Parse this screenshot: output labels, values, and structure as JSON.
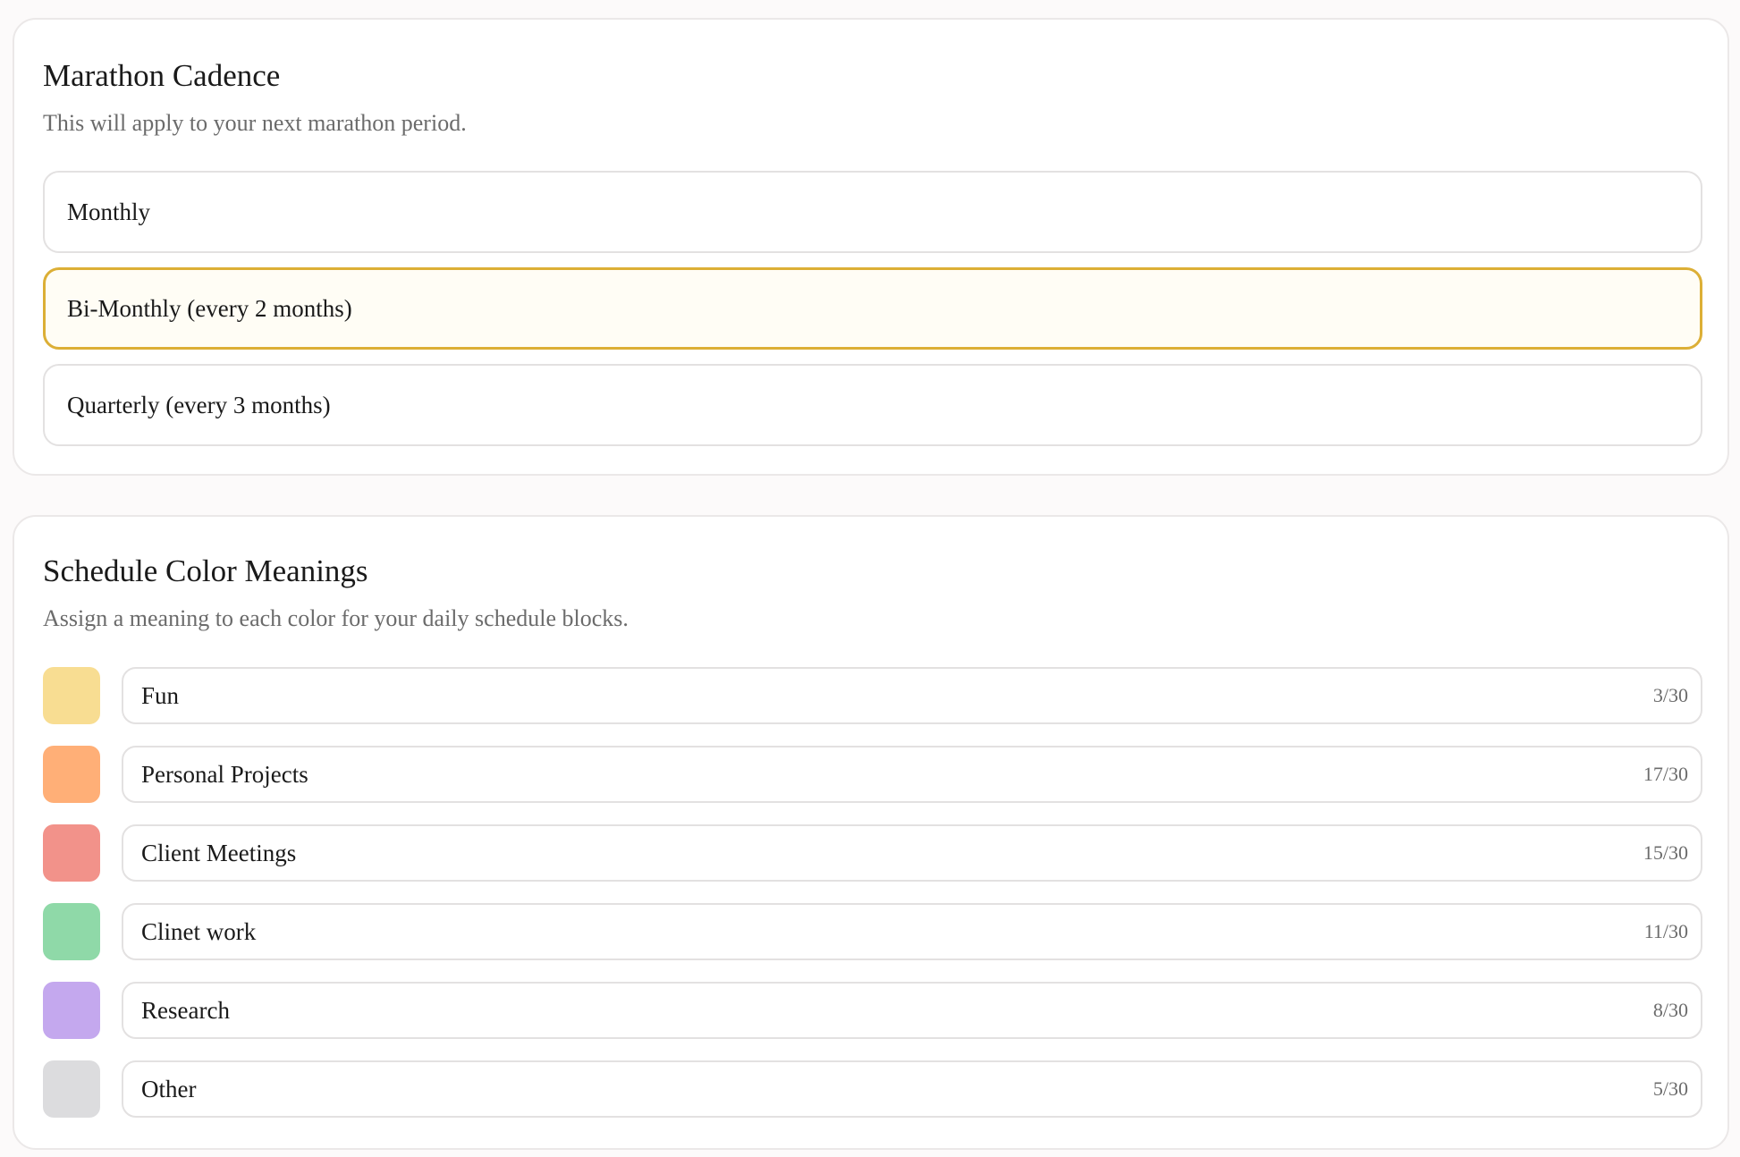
{
  "cadence": {
    "title": "Marathon Cadence",
    "subtitle": "This will apply to your next marathon period.",
    "selected_index": 1,
    "options": [
      {
        "label": "Monthly"
      },
      {
        "label": "Bi-Monthly (every 2 months)"
      },
      {
        "label": "Quarterly (every 3 months)"
      }
    ]
  },
  "schedule_colors": {
    "title": "Schedule Color Meanings",
    "subtitle": "Assign a meaning to each color for your daily schedule blocks.",
    "items": [
      {
        "color": "#f8dd92",
        "value": "Fun",
        "count": "3/30"
      },
      {
        "color": "#ffaf77",
        "value": "Personal Projects",
        "count": "17/30"
      },
      {
        "color": "#f2928a",
        "value": "Client Meetings",
        "count": "15/30"
      },
      {
        "color": "#8fd9a8",
        "value": "Clinet work",
        "count": "11/30"
      },
      {
        "color": "#c4a8ee",
        "value": "Research",
        "count": "8/30"
      },
      {
        "color": "#dcdcde",
        "value": "Other",
        "count": "5/30"
      }
    ]
  },
  "theme": {
    "accent": "#dcaf36",
    "accent_bg": "#fffdf5",
    "border": "#e3e1e1",
    "muted_text": "#6b6b6b"
  }
}
